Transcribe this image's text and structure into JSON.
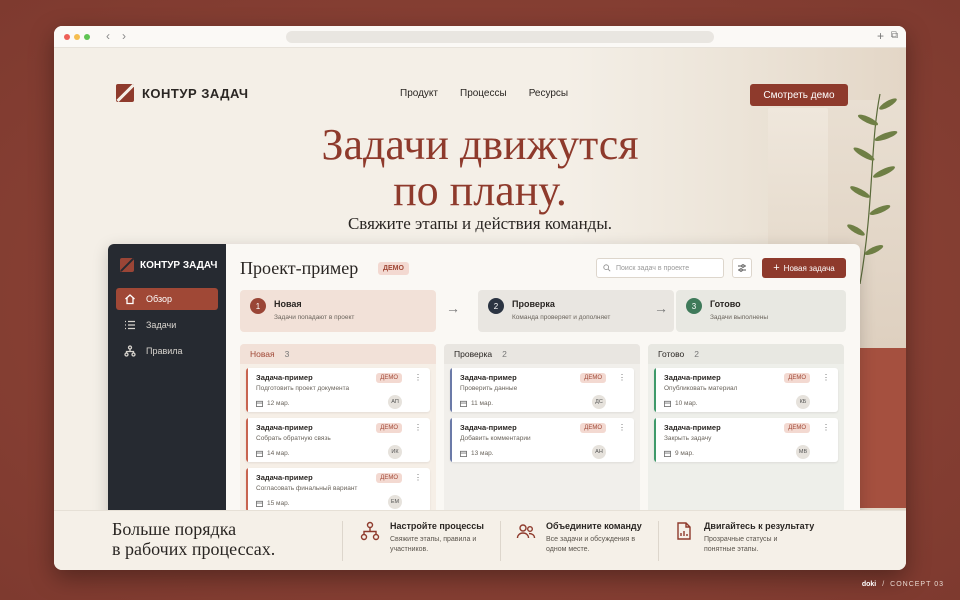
{
  "site": {
    "brand": "КОНТУР ЗАДАЧ",
    "nav": [
      "Продукт",
      "Процессы",
      "Ресурсы"
    ],
    "cta": "Смотреть демо",
    "headline_line1": "Задачи движутся",
    "headline_line2": "по плану.",
    "subheadline": "Свяжите этапы и действия команды."
  },
  "app": {
    "brand": "КОНТУР ЗАДАЧ",
    "sidebar": [
      {
        "label": "Обзор",
        "icon": "home-icon",
        "active": true
      },
      {
        "label": "Задачи",
        "icon": "list-icon",
        "active": false
      },
      {
        "label": "Правила",
        "icon": "flow-icon",
        "active": false
      }
    ],
    "project_title": "Проект-пример",
    "project_badge": "ДЕМО",
    "search_placeholder": "Поиск задач в проекте",
    "new_task": "Новая задача",
    "stages": [
      {
        "num": "1",
        "title": "Новая",
        "desc": "Задачи попадают в проект",
        "color": "#9a4536",
        "bg": "#f2e1d8"
      },
      {
        "num": "2",
        "title": "Проверка",
        "desc": "Команда проверяет и дополняет",
        "color": "#2b3442",
        "bg": "#e9e6e1"
      },
      {
        "num": "3",
        "title": "Готово",
        "desc": "Задачи выполнены",
        "color": "#3f7a5a",
        "bg": "#e8e8e2"
      }
    ],
    "columns": [
      {
        "title": "Новая",
        "count": "3",
        "accent": "#c8644f",
        "cards": [
          {
            "title": "Задача-пример",
            "badge": "ДЕМО",
            "desc": "Подготовить проект документа",
            "date": "12 мар.",
            "avatar": "АП"
          },
          {
            "title": "Задача-пример",
            "badge": "ДЕМО",
            "desc": "Собрать обратную связь",
            "date": "14 мар.",
            "avatar": "ИК"
          },
          {
            "title": "Задача-пример",
            "badge": "ДЕМО",
            "desc": "Согласовать финальный вариант",
            "date": "15 мар.",
            "avatar": "ЕМ"
          }
        ]
      },
      {
        "title": "Проверка",
        "count": "2",
        "accent": "#6b7aa8",
        "cards": [
          {
            "title": "Задача-пример",
            "badge": "ДЕМО",
            "desc": "Проверить данные",
            "date": "11 мар.",
            "avatar": "ДС"
          },
          {
            "title": "Задача-пример",
            "badge": "ДЕМО",
            "desc": "Добавить комментарии",
            "date": "13 мар.",
            "avatar": "АН"
          }
        ]
      },
      {
        "title": "Готово",
        "count": "2",
        "accent": "#3f9a6a",
        "cards": [
          {
            "title": "Задача-пример",
            "badge": "ДЕМО",
            "desc": "Опубликовать материал",
            "date": "10 мар.",
            "avatar": "КБ"
          },
          {
            "title": "Задача-пример",
            "badge": "ДЕМО",
            "desc": "Закрыть задачу",
            "date": "9 мар.",
            "avatar": "МВ"
          }
        ]
      }
    ]
  },
  "bottom": {
    "title_line1": "Больше порядка",
    "title_line2": "в рабочих процессах.",
    "features": [
      {
        "title": "Настройте процессы",
        "desc": "Свяжите этапы, правила и участников.",
        "icon": "flow-icon"
      },
      {
        "title": "Объедините команду",
        "desc": "Все задачи и обсуждения в одном месте.",
        "icon": "team-icon"
      },
      {
        "title": "Двигайтесь к результату",
        "desc": "Прозрачные статусы и понятные этапы.",
        "icon": "report-icon"
      }
    ]
  },
  "footer": {
    "left": "doki",
    "sep": "/",
    "right": "CONCEPT 03"
  }
}
